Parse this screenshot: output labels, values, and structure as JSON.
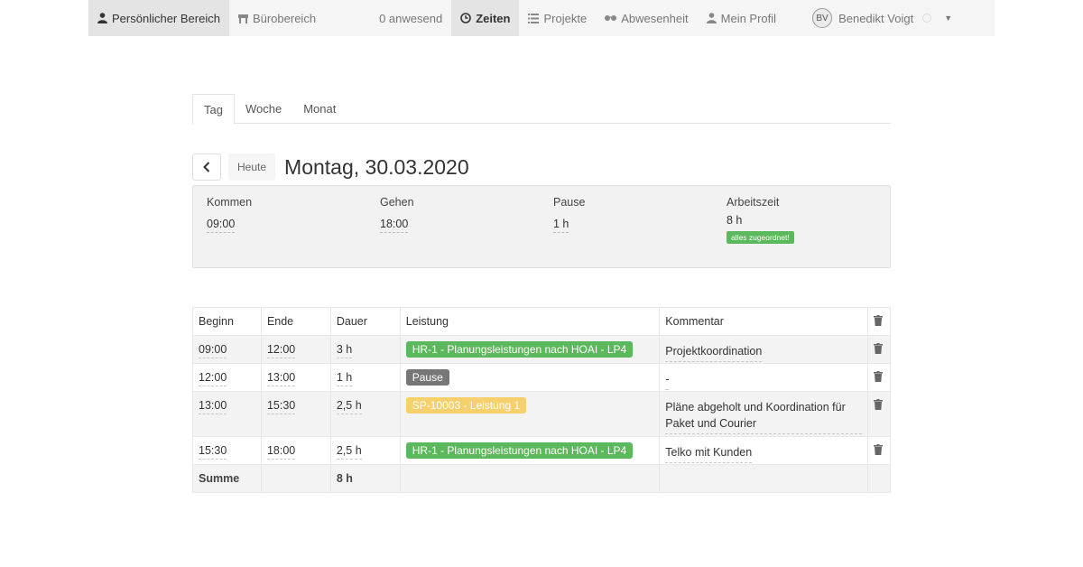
{
  "nav": {
    "personal": "Persönlicher Bereich",
    "office": "Bürobereich",
    "present": "0 anwesend",
    "times": "Zeiten",
    "projects": "Projekte",
    "absence": "Abwesenheit",
    "profile": "Mein Profil",
    "avatar_initials": "BV",
    "user_name": "Benedikt Voigt"
  },
  "tabs": [
    "Tag",
    "Woche",
    "Monat"
  ],
  "datebar": {
    "today": "Heute",
    "title": "Montag, 30.03.2020"
  },
  "summary": {
    "kommen_label": "Kommen",
    "kommen_value": "09:00",
    "gehen_label": "Gehen",
    "gehen_value": "18:00",
    "pause_label": "Pause",
    "pause_value": "1 h",
    "arbeitszeit_label": "Arbeitszeit",
    "arbeitszeit_value": "8 h",
    "badge": "alles zugeordnet!"
  },
  "table": {
    "headers": [
      "Beginn",
      "Ende",
      "Dauer",
      "Leistung",
      "Kommentar"
    ],
    "rows": [
      {
        "begin": "09:00",
        "end": "12:00",
        "duration": "3 h",
        "service": "HR-1 - Planungsleistungen nach HOAI - LP4",
        "service_color": "green",
        "comment": "Projektkoordination"
      },
      {
        "begin": "12:00",
        "end": "13:00",
        "duration": "1 h",
        "service": "Pause",
        "service_color": "grey",
        "comment": "-"
      },
      {
        "begin": "13:00",
        "end": "15:30",
        "duration": "2,5 h",
        "service": "SP-10003 - Leistung 1",
        "service_color": "yellow",
        "comment": "Pläne abgeholt und Koordination für Paket und Courier"
      },
      {
        "begin": "15:30",
        "end": "18:00",
        "duration": "2,5 h",
        "service": "HR-1 - Planungsleistungen nach HOAI - LP4",
        "service_color": "green",
        "comment": "Telko mit Kunden"
      }
    ],
    "sum_label": "Summe",
    "sum_value": "8 h"
  },
  "colors": {
    "green": "#5cb85c",
    "grey": "#777777",
    "yellow": "#f7d06e"
  }
}
